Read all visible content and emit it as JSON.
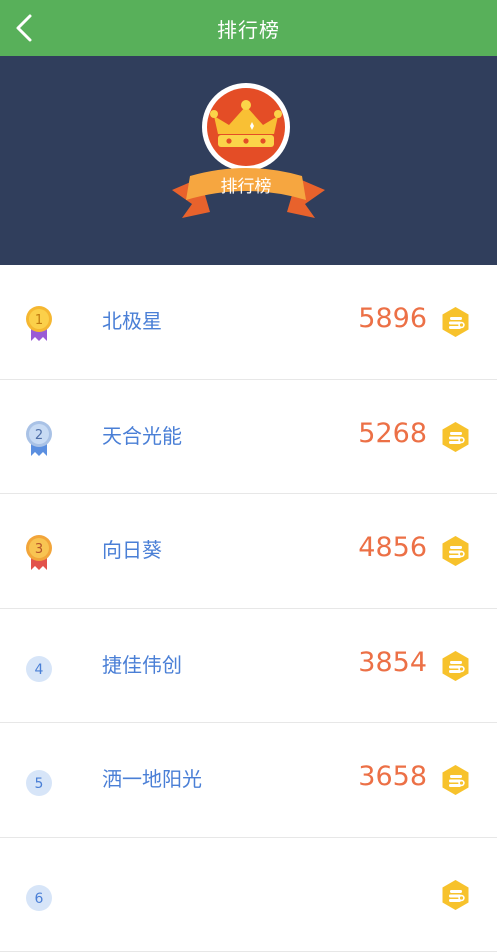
{
  "header": {
    "title": "排行榜"
  },
  "banner": {
    "ribbon_text": "排行榜"
  },
  "ranking": [
    {
      "rank": "1",
      "name": "北极星",
      "score": "5896",
      "medal": "gold"
    },
    {
      "rank": "2",
      "name": "天合光能",
      "score": "5268",
      "medal": "silver"
    },
    {
      "rank": "3",
      "name": "向日葵",
      "score": "4856",
      "medal": "bronze"
    },
    {
      "rank": "4",
      "name": "捷佳伟创",
      "score": "3854",
      "medal": "plain"
    },
    {
      "rank": "5",
      "name": "洒一地阳光",
      "score": "3658",
      "medal": "plain"
    },
    {
      "rank": "6",
      "name": "",
      "score": "",
      "medal": "plain"
    }
  ],
  "colors": {
    "header_bg": "#58b05a",
    "banner_bg": "#303e5c",
    "name_text": "#4a7fd6",
    "score_text": "#ec7046",
    "coin": "#f7c22c"
  }
}
